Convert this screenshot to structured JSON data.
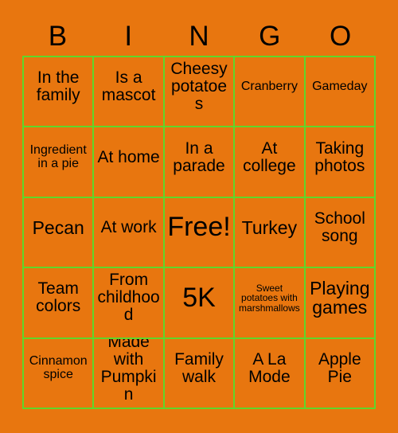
{
  "card": {
    "background_color": "#e8760f",
    "grid_line_color": "#5fd72a",
    "text_color": "#000000"
  },
  "header": {
    "letters": [
      "B",
      "I",
      "N",
      "G",
      "O"
    ]
  },
  "grid": {
    "rows": 5,
    "columns": 5,
    "cells": [
      [
        {
          "label": "In the family",
          "size": "md"
        },
        {
          "label": "Is a mascot",
          "size": "md"
        },
        {
          "label": "Cheesy potatoes",
          "size": "md"
        },
        {
          "label": "Cranberry",
          "size": "sm"
        },
        {
          "label": "Gameday",
          "size": "sm"
        }
      ],
      [
        {
          "label": "Ingredient in a pie",
          "size": "sm"
        },
        {
          "label": "At home",
          "size": "md"
        },
        {
          "label": "In a parade",
          "size": "md"
        },
        {
          "label": "At college",
          "size": "md"
        },
        {
          "label": "Taking photos",
          "size": "md"
        }
      ],
      [
        {
          "label": "Pecan",
          "size": "lg"
        },
        {
          "label": "At work",
          "size": "md"
        },
        {
          "label": "Free!",
          "size": "xl"
        },
        {
          "label": "Turkey",
          "size": "lg"
        },
        {
          "label": "School song",
          "size": "md"
        }
      ],
      [
        {
          "label": "Team colors",
          "size": "md"
        },
        {
          "label": "From childhood",
          "size": "md"
        },
        {
          "label": "5K",
          "size": "xl"
        },
        {
          "label": "Sweet potatoes with marshmallows",
          "size": "xs"
        },
        {
          "label": "Playing games",
          "size": "lg"
        }
      ],
      [
        {
          "label": "Cinnamon spice",
          "size": "sm"
        },
        {
          "label": "Made with Pumpkin",
          "size": "md"
        },
        {
          "label": "Family walk",
          "size": "md"
        },
        {
          "label": "A La Mode",
          "size": "md"
        },
        {
          "label": "Apple Pie",
          "size": "md"
        }
      ]
    ]
  }
}
